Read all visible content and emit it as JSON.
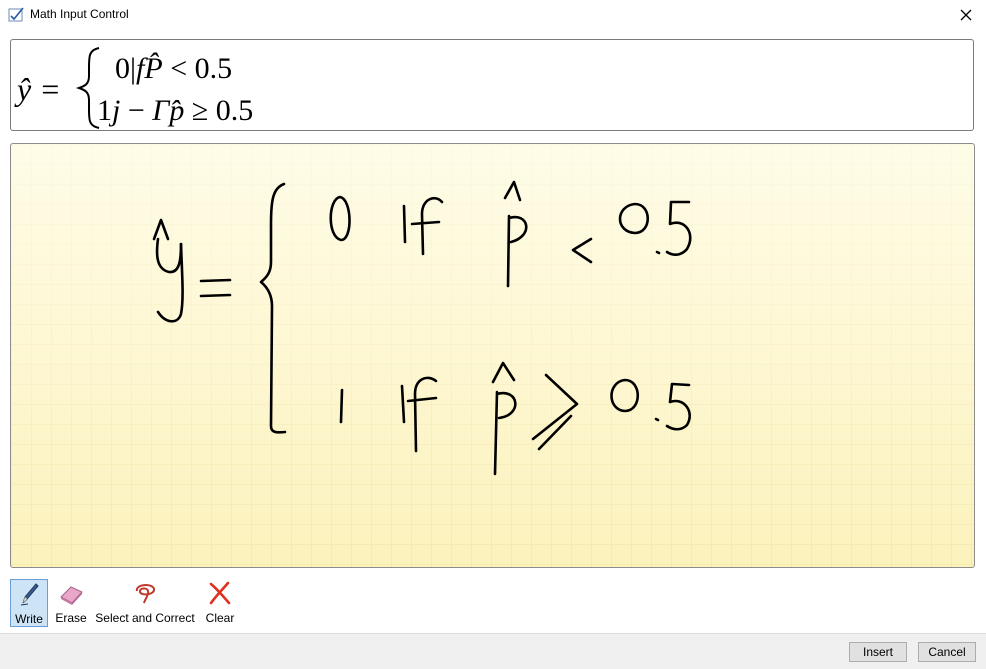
{
  "window": {
    "title": "Math Input Control"
  },
  "preview": {
    "lhs": "ŷ =",
    "row1": {
      "a": "0|",
      "b": "f",
      "c": "P̂",
      "d": " < 0.5"
    },
    "row2": {
      "a": "1",
      "b": "j",
      "c": " − ",
      "d": "Γ",
      "e": "p̂",
      "f": " ≥ 0.5"
    }
  },
  "toolbar": {
    "write_label": "Write",
    "erase_label": "Erase",
    "select_label": "Select and Correct",
    "clear_label": "Clear"
  },
  "buttons": {
    "insert_label": "Insert",
    "cancel_label": "Cancel"
  },
  "colors": {
    "ink": "#000000",
    "accent_active": "#cde4f7",
    "clear_x": "#e0301e"
  }
}
